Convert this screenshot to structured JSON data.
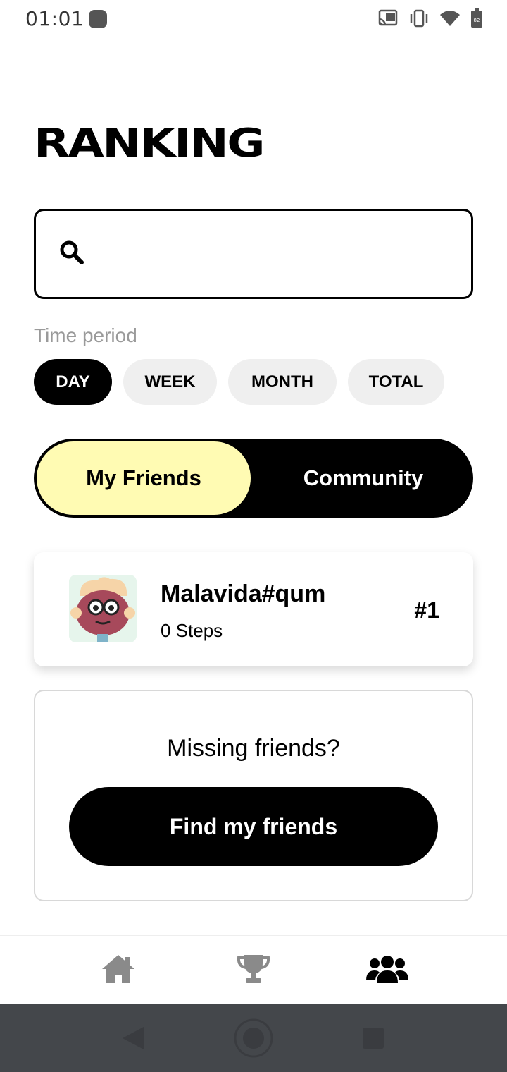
{
  "status_bar": {
    "time": "01:01",
    "battery_level": "82"
  },
  "page": {
    "title": "RANKING"
  },
  "search": {
    "value": "",
    "placeholder": ""
  },
  "time_period": {
    "label": "Time period",
    "options": [
      "DAY",
      "WEEK",
      "MONTH",
      "TOTAL"
    ],
    "selected": "DAY"
  },
  "segment": {
    "left_label": "My Friends",
    "right_label": "Community",
    "selected": "My Friends"
  },
  "ranking_list": [
    {
      "name": "Malavida#qum",
      "steps": "0 Steps",
      "rank": "#1"
    }
  ],
  "missing_friends": {
    "text": "Missing friends?",
    "button_label": "Find my friends"
  },
  "bottom_nav": {
    "items": [
      "home-icon",
      "trophy-icon",
      "friends-icon"
    ],
    "active": "friends-icon"
  },
  "colors": {
    "accent_yellow": "#fffbb3",
    "chip_inactive": "#efefef",
    "nav_inactive": "#8a8a8a",
    "system_nav_bg": "#44474b"
  }
}
